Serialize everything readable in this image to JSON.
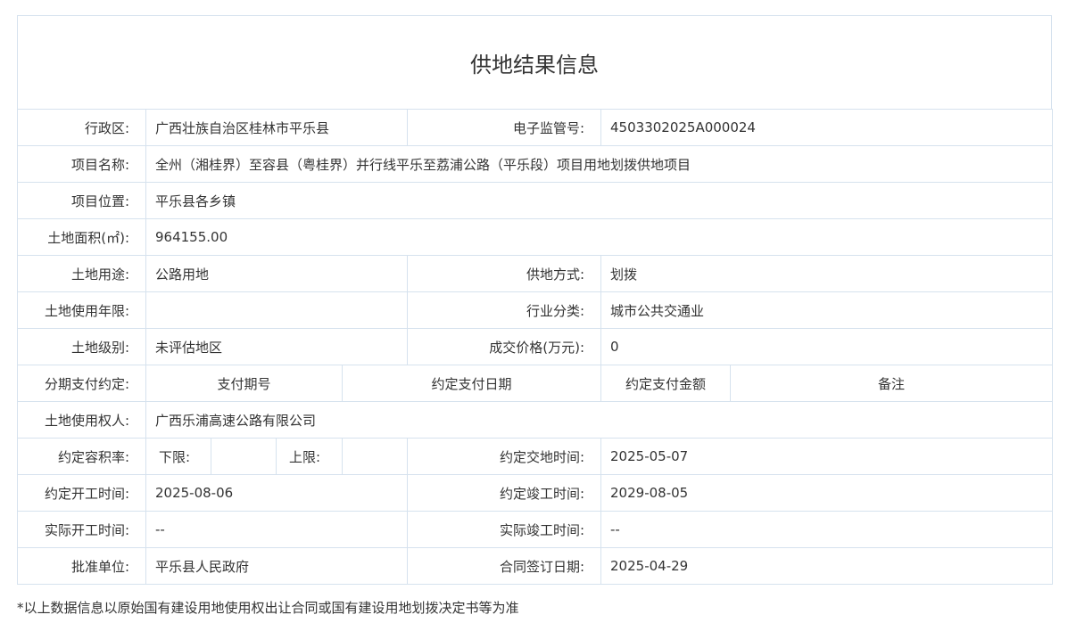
{
  "title": "供地结果信息",
  "rows": {
    "region": {
      "label": "行政区:",
      "value": "广西壮族自治区桂林市平乐县"
    },
    "supervision_no": {
      "label": "电子监管号:",
      "value": "4503302025A000024"
    },
    "project_name": {
      "label": "项目名称:",
      "value": "全州（湘桂界）至容县（粤桂界）并行线平乐至荔浦公路（平乐段）项目用地划拨供地项目"
    },
    "project_location": {
      "label": "项目位置:",
      "value": "平乐县各乡镇"
    },
    "land_area": {
      "label": "土地面积(㎡):",
      "value": "964155.00"
    },
    "land_use": {
      "label": "土地用途:",
      "value": "公路用地"
    },
    "supply_method": {
      "label": "供地方式:",
      "value": "划拨"
    },
    "use_term": {
      "label": "土地使用年限:",
      "value": ""
    },
    "industry": {
      "label": "行业分类:",
      "value": "城市公共交通业"
    },
    "land_grade": {
      "label": "土地级别:",
      "value": "未评估地区"
    },
    "deal_price": {
      "label": "成交价格(万元):",
      "value": "0"
    },
    "installment": {
      "label": "分期支付约定:",
      "cols": [
        "支付期号",
        "约定支付日期",
        "约定支付金额",
        "备注"
      ]
    },
    "land_user": {
      "label": "土地使用权人:",
      "value": "广西乐浦高速公路有限公司"
    },
    "plot_ratio": {
      "label": "约定容积率:",
      "lower_label": "下限:",
      "lower_value": "",
      "upper_label": "上限:",
      "upper_value": ""
    },
    "delivery_time": {
      "label": "约定交地时间:",
      "value": "2025-05-07"
    },
    "planned_start": {
      "label": "约定开工时间:",
      "value": "2025-08-06"
    },
    "planned_completion": {
      "label": "约定竣工时间:",
      "value": "2029-08-05"
    },
    "actual_start": {
      "label": "实际开工时间:",
      "value": "--"
    },
    "actual_completion": {
      "label": "实际竣工时间:",
      "value": "--"
    },
    "approval_unit": {
      "label": "批准单位:",
      "value": "平乐县人民政府"
    },
    "contract_date": {
      "label": "合同签订日期:",
      "value": "2025-04-29"
    }
  },
  "footnote": "*以上数据信息以原始国有建设用地使用权出让合同或国有建设用地划拨决定书等为准"
}
